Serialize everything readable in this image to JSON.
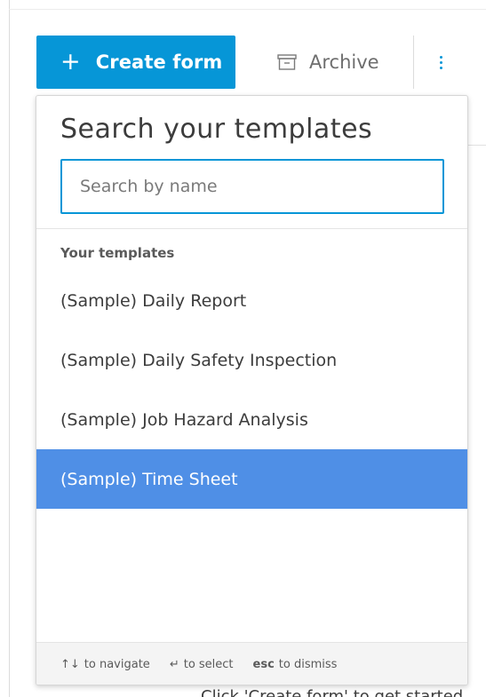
{
  "toolbar": {
    "create_label": "Create form",
    "create_icon": "plus-icon",
    "archive_label": "Archive",
    "archive_icon": "archive-box-icon",
    "more_icon": "vertical-ellipsis-icon"
  },
  "dropdown": {
    "title": "Search your templates",
    "search_placeholder": "Search by name",
    "search_value": "",
    "section_label": "Your templates",
    "templates": [
      {
        "label": "(Sample) Daily Report",
        "selected": false
      },
      {
        "label": "(Sample) Daily Safety Inspection",
        "selected": false
      },
      {
        "label": "(Sample) Job Hazard Analysis",
        "selected": false
      },
      {
        "label": "(Sample) Time Sheet",
        "selected": true
      }
    ],
    "footer": {
      "navigate_keys": "↑↓",
      "navigate_text": "to navigate",
      "select_key": "↵",
      "select_text": "to select",
      "dismiss_key": "esc",
      "dismiss_text": "to dismiss"
    }
  },
  "background_text": "Click 'Create form' to get started",
  "colors": {
    "primary": "#0696d7",
    "selected_row": "#4f8fe6",
    "text": "#3c3c3c",
    "footer_bg": "#f4f4f4"
  }
}
